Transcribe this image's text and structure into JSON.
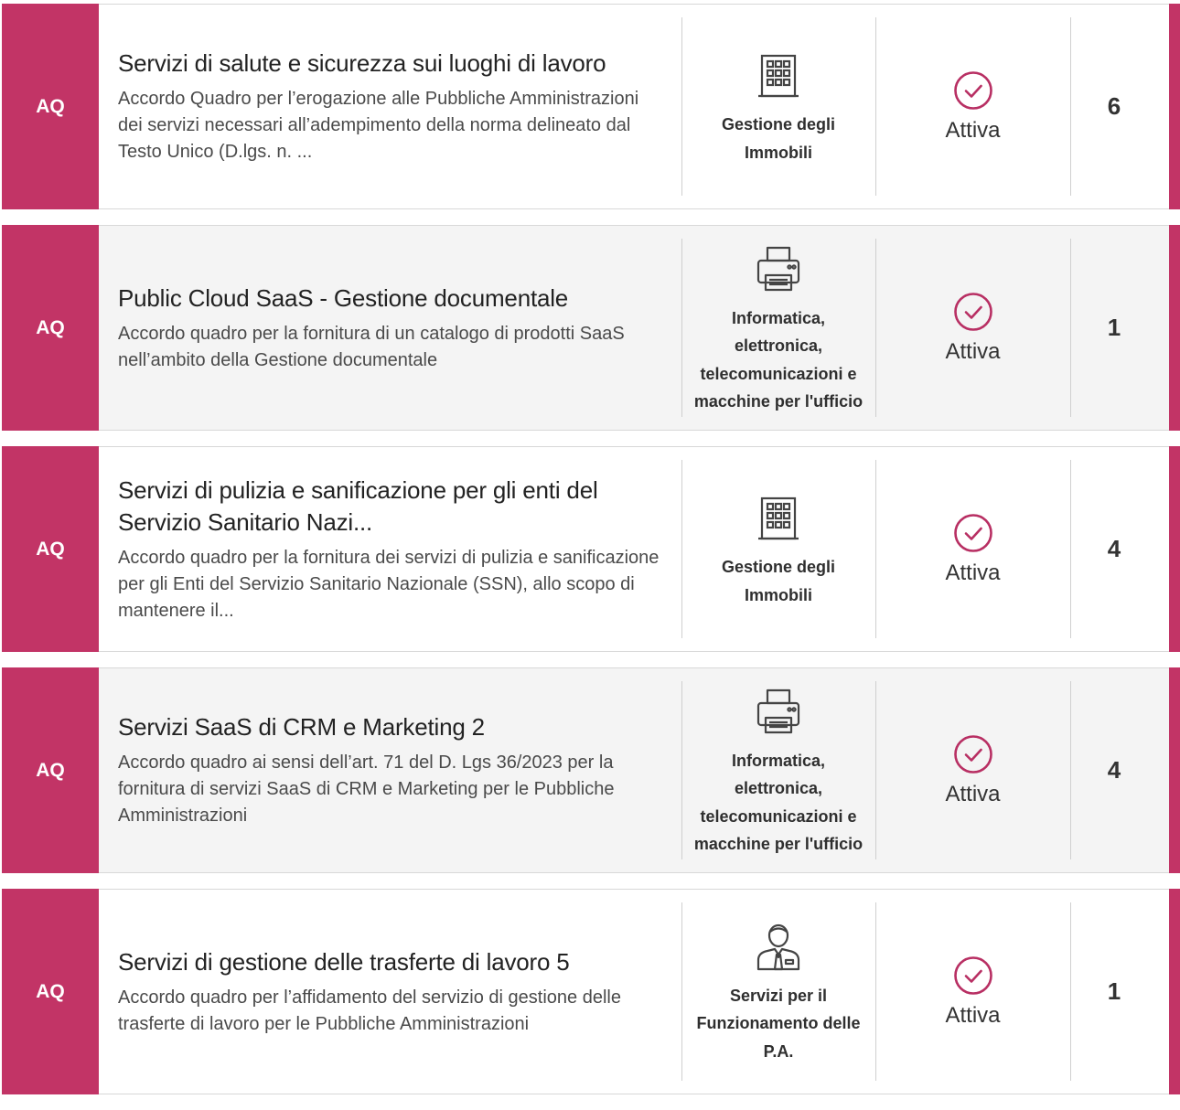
{
  "colors": {
    "accent": "#c23466",
    "card_alt_bg": "#f4f4f4",
    "text": "#333333"
  },
  "cards": [
    {
      "badge": "AQ",
      "title": "Servizi di salute e sicurezza sui luoghi di lavoro",
      "description": "Accordo Quadro per l’erogazione alle Pubbliche Amministrazioni dei servizi necessari all’adempimento della norma delineato dal Testo Unico (D.lgs. n. ...",
      "category_icon": "building-icon",
      "category": "Gestione degli Immobili",
      "status_icon": "check-circle-icon",
      "status": "Attiva",
      "count": "6"
    },
    {
      "badge": "AQ",
      "title": "Public Cloud SaaS - Gestione documentale",
      "description": "Accordo quadro per la fornitura di un catalogo di prodotti SaaS nell’ambito della Gestione documentale",
      "category_icon": "printer-icon",
      "category": "Informatica, elettronica, telecomunicazioni e macchine per l'ufficio",
      "status_icon": "check-circle-icon",
      "status": "Attiva",
      "count": "1"
    },
    {
      "badge": "AQ",
      "title": "Servizi di pulizia e sanificazione per gli enti del Servizio Sanitario Nazi...",
      "description": "Accordo quadro per la fornitura dei servizi di pulizia e sanificazione per gli Enti del Servizio Sanitario Nazionale (SSN), allo scopo di mantenere il...",
      "category_icon": "building-icon",
      "category": "Gestione degli Immobili",
      "status_icon": "check-circle-icon",
      "status": "Attiva",
      "count": "4"
    },
    {
      "badge": "AQ",
      "title": "Servizi SaaS di CRM e Marketing 2",
      "description": "Accordo quadro ai sensi dell’art. 71 del D. Lgs 36/2023 per la fornitura di servizi SaaS di CRM e Marketing per le Pubbliche Amministrazioni",
      "category_icon": "printer-icon",
      "category": "Informatica, elettronica, telecomunicazioni e macchine per l'ufficio",
      "status_icon": "check-circle-icon",
      "status": "Attiva",
      "count": "4"
    },
    {
      "badge": "AQ",
      "title": "Servizi di gestione delle trasferte di lavoro 5",
      "description": "Accordo quadro per l’affidamento del servizio di gestione delle trasferte di lavoro per le Pubbliche Amministrazioni",
      "category_icon": "businessman-icon",
      "category": "Servizi per il Funzionamento delle P.A.",
      "status_icon": "check-circle-icon",
      "status": "Attiva",
      "count": "1"
    }
  ]
}
